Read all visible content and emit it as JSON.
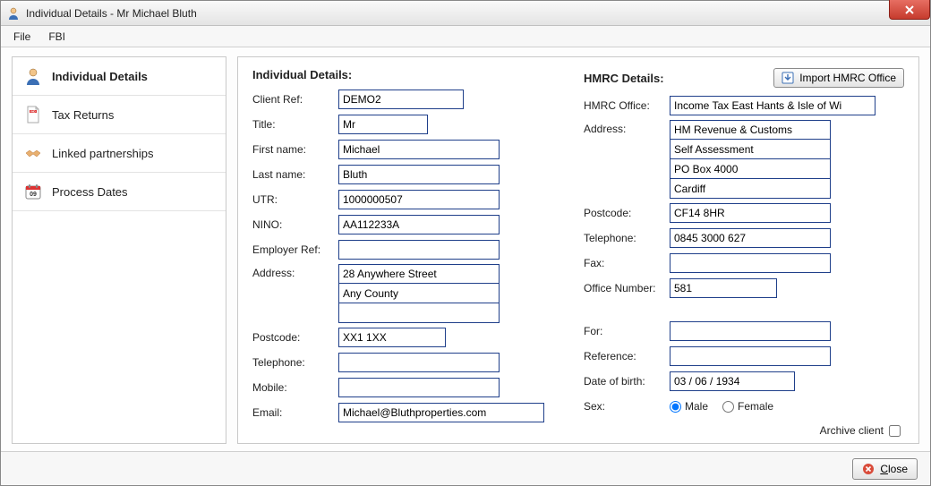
{
  "window": {
    "title": "Individual Details - Mr Michael Bluth"
  },
  "menubar": {
    "file": "File",
    "fbi": "FBI"
  },
  "sidebar": {
    "items": [
      {
        "label": "Individual Details"
      },
      {
        "label": "Tax Returns"
      },
      {
        "label": "Linked partnerships"
      },
      {
        "label": "Process Dates"
      }
    ]
  },
  "form": {
    "left_title": "Individual Details:",
    "right_title": "HMRC Details:",
    "import_button": "Import HMRC Office",
    "labels": {
      "client_ref": "Client Ref:",
      "title": "Title:",
      "first_name": "First name:",
      "last_name": "Last name:",
      "utr": "UTR:",
      "nino": "NINO:",
      "employer_ref": "Employer Ref:",
      "address": "Address:",
      "postcode": "Postcode:",
      "telephone": "Telephone:",
      "mobile": "Mobile:",
      "email": "Email:",
      "hmrc_office": "HMRC Office:",
      "fax": "Fax:",
      "office_number": "Office Number:",
      "for": "For:",
      "reference": "Reference:",
      "dob": "Date of birth:",
      "sex": "Sex:",
      "male": "Male",
      "female": "Female",
      "archive": "Archive client"
    },
    "values": {
      "client_ref": "DEMO2",
      "title": "Mr",
      "first_name": "Michael",
      "last_name": "Bluth",
      "utr": "1000000507",
      "nino": "AA112233A",
      "employer_ref": "",
      "address1": "28 Anywhere Street",
      "address2": "Any County",
      "address3": "",
      "postcode": "XX1 1XX",
      "telephone": "",
      "mobile": "",
      "email": "Michael@Bluthproperties.com",
      "hmrc_office": "Income Tax East Hants & Isle of Wi",
      "hmrc_addr1": "HM Revenue & Customs",
      "hmrc_addr2": "Self Assessment",
      "hmrc_addr3": "PO Box 4000",
      "hmrc_addr4": "Cardiff",
      "hmrc_postcode": "CF14 8HR",
      "hmrc_telephone": "0845 3000 627",
      "hmrc_fax": "",
      "office_number": "581",
      "for": "",
      "reference": "",
      "dob": "03 / 06 / 1934",
      "sex": "male",
      "archive": false
    }
  },
  "footer": {
    "close_prefix": "C",
    "close_rest": "lose"
  }
}
